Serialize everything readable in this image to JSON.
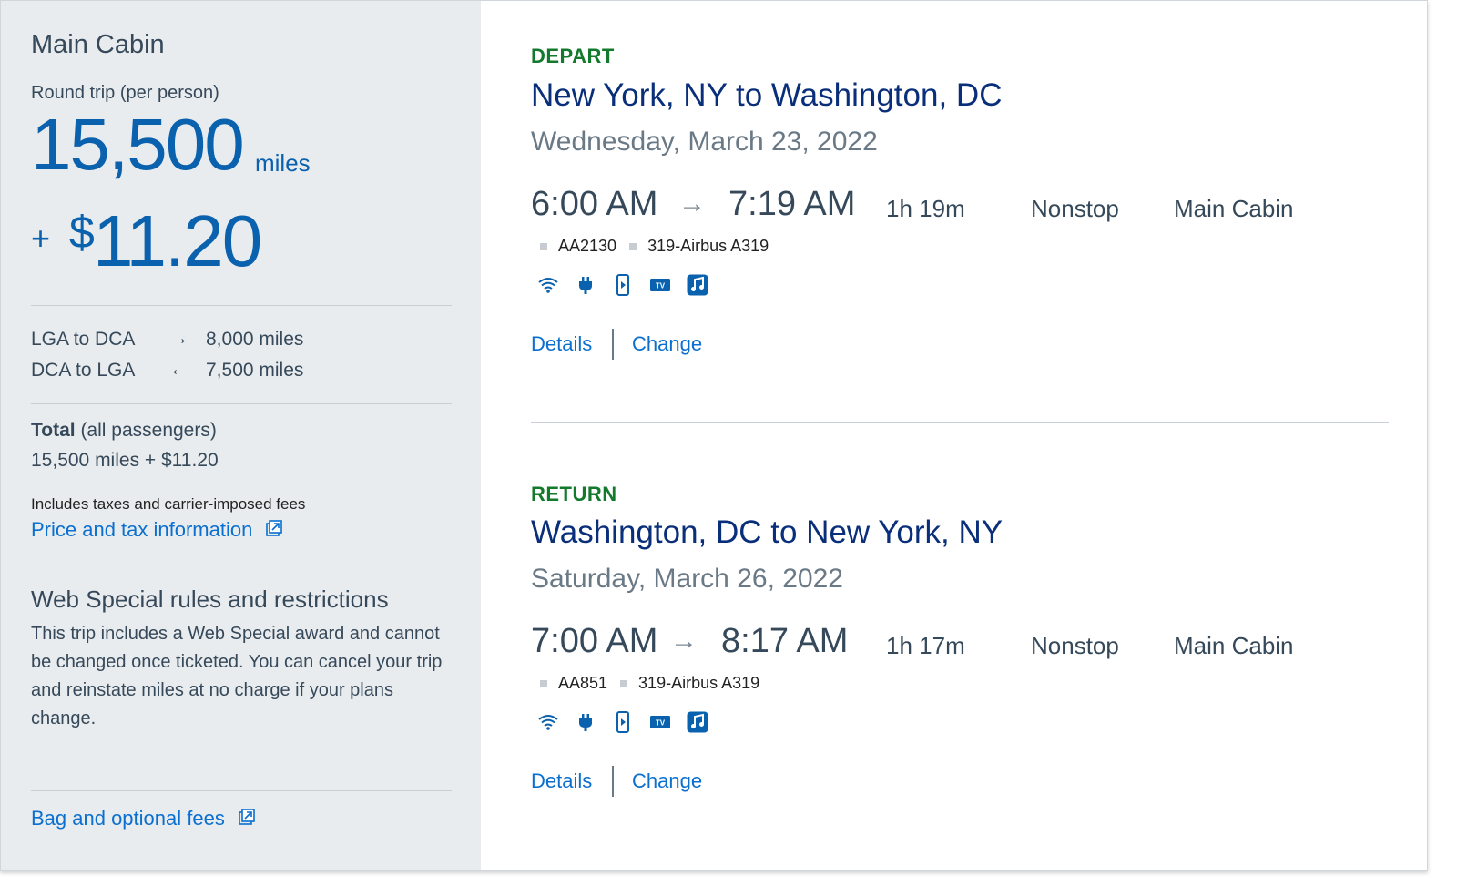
{
  "summary": {
    "cabin": "Main Cabin",
    "trip_type": "Round trip (per person)",
    "miles": "15,500",
    "miles_unit": "miles",
    "plus": "+",
    "currency": "$",
    "cash": "11.20",
    "segments": [
      {
        "route": "LGA to DCA",
        "arrow": "→",
        "miles": "8,000 miles"
      },
      {
        "route": "DCA to LGA",
        "arrow": "←",
        "miles": "7,500 miles"
      }
    ],
    "total_label": "Total",
    "total_suffix": " (all passengers)",
    "total_value": "15,500 miles + $11.20",
    "fees_note": "Includes taxes and carrier-imposed fees",
    "price_link": "Price and tax information",
    "rules_title": "Web Special rules and restrictions",
    "rules_body": "This trip includes a Web Special award and cannot be changed once ticketed. You can cancel your trip and reinstate miles at no charge if your plans change.",
    "bag_link": "Bag and optional fees"
  },
  "flights": [
    {
      "direction": "DEPART",
      "route": "New York, NY to Washington, DC",
      "date": "Wednesday, March 23, 2022",
      "depart_time": "6:00 AM",
      "arrive_time": "7:19 AM",
      "duration": "1h 19m",
      "stops": "Nonstop",
      "cabin": "Main Cabin",
      "flight_number": "AA2130",
      "aircraft": "319-Airbus A319",
      "details_label": "Details",
      "change_label": "Change"
    },
    {
      "direction": "RETURN",
      "route": "Washington, DC to New York, NY",
      "date": "Saturday, March 26, 2022",
      "depart_time": "7:00 AM",
      "arrive_time": "8:17 AM",
      "duration": "1h 17m",
      "stops": "Nonstop",
      "cabin": "Main Cabin",
      "flight_number": "AA851",
      "aircraft": "319-Airbus A319",
      "details_label": "Details",
      "change_label": "Change"
    }
  ],
  "amenity_icons": [
    "wifi-icon",
    "power-outlet-icon",
    "device-entertainment-icon",
    "tv-icon",
    "music-icon"
  ],
  "colors": {
    "accent_blue": "#0a61ad",
    "link_blue": "#0a6fcf",
    "route_navy": "#0a2f7a",
    "direction_green": "#137a2d",
    "summary_bg": "#e9ecee"
  }
}
